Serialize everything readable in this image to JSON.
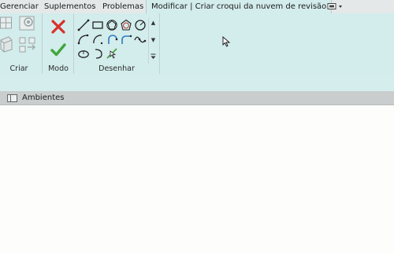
{
  "tabs": [
    {
      "label": "Gerenciar"
    },
    {
      "label": "Suplementos"
    },
    {
      "label": "Problemas"
    },
    {
      "label": "Modificar | Criar croqui da nuvem de revisão"
    }
  ],
  "quick_access": {
    "icon": "window-switch-icon"
  },
  "ribbon": {
    "panels": {
      "criar": "Criar",
      "modo": "Modo",
      "desenhar": "Desenhar"
    }
  },
  "browser": {
    "label": "Ambientes",
    "icon": "folder-icon"
  },
  "colors": {
    "ribbon": "#d3ecec",
    "tabbar": "#e4e8e8",
    "finish_green": "#3fa63c",
    "cancel_red": "#d9302a",
    "draw_blue": "#2e7bbf"
  }
}
